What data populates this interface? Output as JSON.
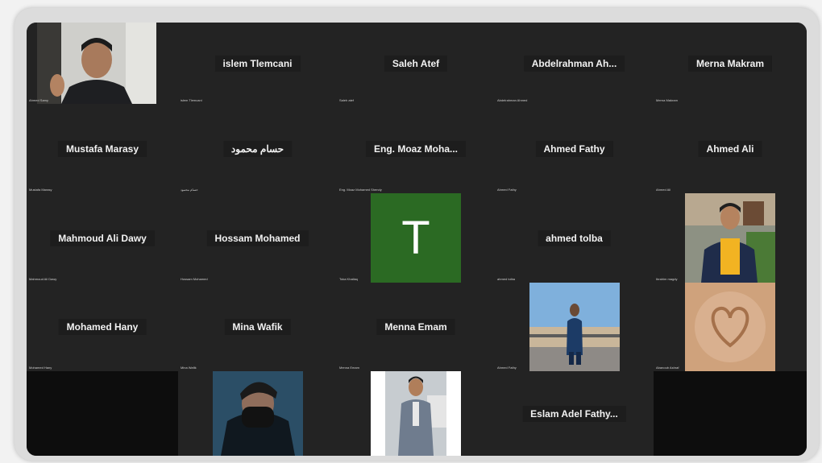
{
  "tiles": [
    {
      "name": "",
      "caption": "Ahmed Samy"
    },
    {
      "name": "islem Tlemcani",
      "caption": "islem Tlemcani"
    },
    {
      "name": "Saleh Atef",
      "caption": "Saleh atef"
    },
    {
      "name": "Abdelrahman  Ah...",
      "caption": "Abdelrahman Ahmed"
    },
    {
      "name": "Merna Makram",
      "caption": "Merna Makram"
    },
    {
      "name": "Mustafa Marasy",
      "caption": "Mustafa Marasy"
    },
    {
      "name": "حسام محمود",
      "caption": "حسام محمود"
    },
    {
      "name": "Eng.  Moaz  Moha...",
      "caption": "Eng. Moaz Mohamed Shendy"
    },
    {
      "name": "Ahmed Fathy",
      "caption": "Ahmed Fathy"
    },
    {
      "name": "Ahmed Ali",
      "caption": "Ahmed Ali"
    },
    {
      "name": "Mahmoud Ali Dawy",
      "caption": "Mahmoud Ali Dawy"
    },
    {
      "name": "Hossam Mohamed",
      "caption": "Hossam Mohamed"
    },
    {
      "name": "T",
      "caption": "Toka Khallaq"
    },
    {
      "name": "ahmed tolba",
      "caption": "ahmed tolba"
    },
    {
      "name": "",
      "caption": "Ibrahim magdy"
    },
    {
      "name": "Mohamed Hany",
      "caption": "Mohamed Hany"
    },
    {
      "name": "Mina Wafik",
      "caption": "Mina Wafik"
    },
    {
      "name": "Menna Emam",
      "caption": "Menna Emam"
    },
    {
      "name": "",
      "caption": "Ahmed Fathy"
    },
    {
      "name": "",
      "caption": "Abanoub Ashraf"
    },
    {
      "name": "",
      "caption": ""
    },
    {
      "name": "",
      "caption": ""
    },
    {
      "name": "",
      "caption": ""
    },
    {
      "name": "Eslam  Adel  Fathy...",
      "caption": ""
    },
    {
      "name": "",
      "caption": ""
    }
  ],
  "colors": {
    "background": "#232323",
    "label_bg": "#1d1d1d",
    "avatar_green": "#2b6a23",
    "empty_tile": "#0d0d0d"
  }
}
